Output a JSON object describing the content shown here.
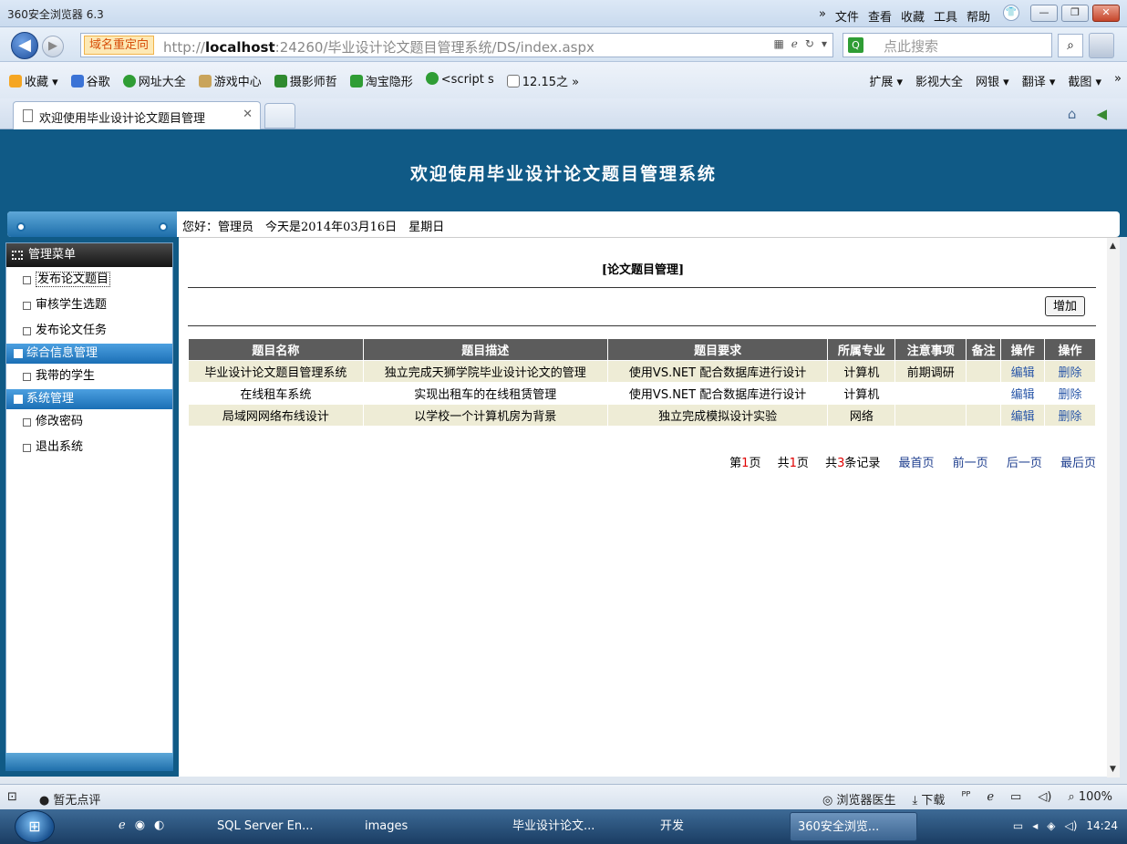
{
  "browser": {
    "app_title": "360安全浏览器 6.3",
    "menus": [
      "»",
      "文件",
      "查看",
      "收藏",
      "工具",
      "帮助"
    ],
    "window_buttons": [
      "—",
      "❐",
      "✕"
    ],
    "redirect_tag": "域名重定向",
    "url_prefix": "http://",
    "url_host": "localhost",
    "url_rest": ":24260/毕业设计论文题目管理系统/DS/index.aspx",
    "search_placeholder": "点此搜索",
    "favorites": [
      "收藏 ▾",
      "谷歌",
      "网址大全",
      "游戏中心",
      "摄影师哲",
      "淘宝隐形",
      "<script s",
      "12.15之 »"
    ],
    "favorites_right": [
      "扩展 ▾",
      "影视大全",
      "网银 ▾",
      "翻译 ▾",
      "截图 ▾",
      "»"
    ],
    "tab_title": "欢迎使用毕业设计论文题目管理",
    "tab_close": "✕"
  },
  "page": {
    "banner_title": "欢迎使用毕业设计论文题目管理系统",
    "greeting_prefix": "您好：管理员　今天是",
    "greeting_date": "2014年03月16日",
    "greeting_weekday": "　星期日"
  },
  "sidebar": {
    "menu_title": "管理菜单",
    "group1_items": [
      "发布论文题目",
      "审核学生选题",
      "发布论文任务"
    ],
    "group2_title": "综合信息管理",
    "group2_items": [
      "我带的学生"
    ],
    "group3_title": "系统管理",
    "group3_items": [
      "修改密码",
      "退出系统"
    ]
  },
  "main": {
    "module_title": "[论文题目管理]",
    "add_button": "增加",
    "columns": [
      "题目名称",
      "题目描述",
      "题目要求",
      "所属专业",
      "注意事项",
      "备注",
      "操作",
      "操作"
    ],
    "rows": [
      [
        "毕业设计论文题目管理系统",
        "独立完成天狮学院毕业设计论文的管理",
        "使用VS.NET 配合数据库进行设计",
        "计算机",
        "前期调研",
        "",
        "编辑",
        "删除"
      ],
      [
        "在线租车系统",
        "实现出租车的在线租赁管理",
        "使用VS.NET 配合数据库进行设计",
        "计算机",
        "",
        "",
        "编辑",
        "删除"
      ],
      [
        "局域网网络布线设计",
        "以学校一个计算机房为背景",
        "独立完成模拟设计实验",
        "网络",
        "",
        "",
        "编辑",
        "删除"
      ]
    ],
    "pager": {
      "page_prefix": "第",
      "page_num": "1",
      "page_suffix": "页",
      "total_prefix": "共",
      "total_pages": "1",
      "total_suffix": "页",
      "rec_prefix": "共",
      "rec_count": "3",
      "rec_suffix": "条记录",
      "first": "最首页",
      "prev": "前一页",
      "next": "后一页",
      "last": "最后页"
    }
  },
  "statusbar": {
    "rating": "暂无点评",
    "doctor": "浏览器医生",
    "download": "下载",
    "zoom": "100%"
  },
  "taskbar": {
    "tasks": [
      "SQL Server En...",
      "images",
      "毕业设计论文...",
      "开发",
      "360安全浏览..."
    ],
    "time": "14:24"
  },
  "colors": {
    "banner": "#105a86",
    "header": "#5c5c5c",
    "odd_row": "#eeecd6",
    "link": "#2a57a8"
  }
}
